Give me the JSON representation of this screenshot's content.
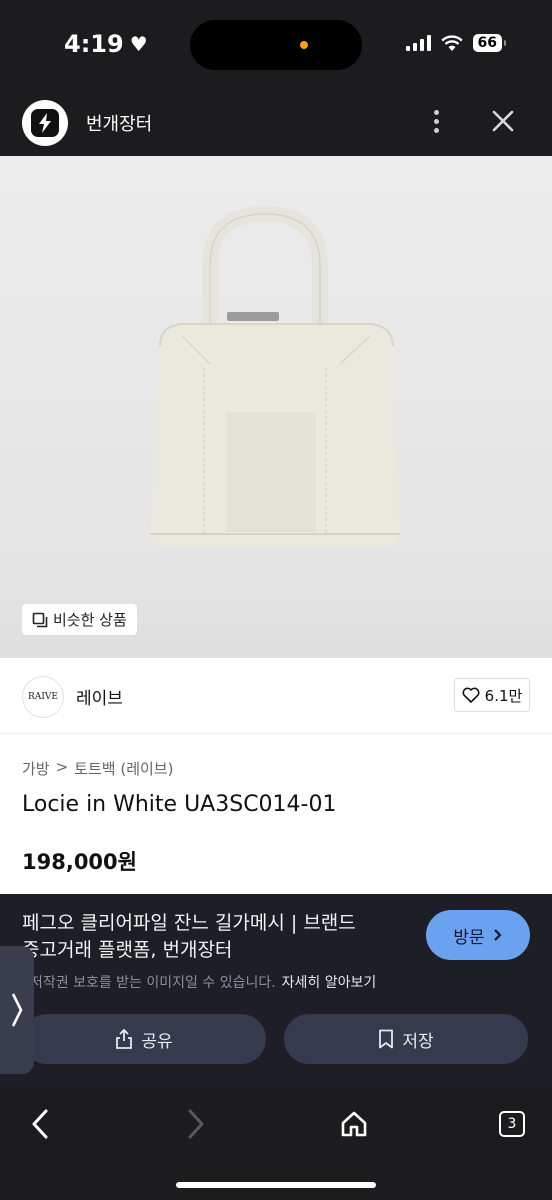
{
  "status_bar": {
    "time": "4:19",
    "battery": "66"
  },
  "app_header": {
    "title": "번개장터"
  },
  "product_image": {
    "similar_label": "비슷한 상품"
  },
  "shop": {
    "logo_text": "RAIVE",
    "name": "레이브",
    "likes": "6.1만"
  },
  "breadcrumb": {
    "category": "가방",
    "separator": ">",
    "subcategory": "토트백 (레이브)"
  },
  "product": {
    "title": "Locie in White UA3SC014-01",
    "price": "198,000원"
  },
  "ad_sheet": {
    "title_line1": "페그오 클리어파일 잔느 길가메시 | 브랜드",
    "title_line2": "중고거래 플랫폼, 번개장터",
    "visit_label": "방문",
    "copyright_text": "저작권 보호를 받는 이미지일 수 있습니다.",
    "learn_more": "자세히 알아보기",
    "share_label": "공유",
    "save_label": "저장"
  },
  "toolbar": {
    "tab_count": "3"
  },
  "colors": {
    "accent_blue": "#6aa2f0",
    "sheet_bg": "#1e1f26",
    "button_bg": "#363a4e"
  }
}
